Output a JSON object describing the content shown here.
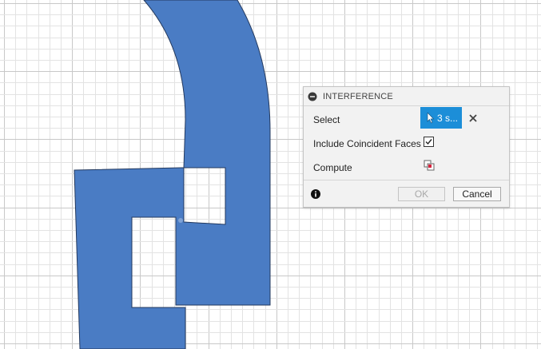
{
  "canvas": {
    "background": "#ffffff",
    "grid_minor_color": "#e3e3e3",
    "grid_major_color": "#c8c8c8",
    "body_fill": "#4a7cc4",
    "body_edge": "#23395e"
  },
  "panel": {
    "title": "INTERFERENCE",
    "collapse_icon": "minus-circle-icon",
    "select_label": "Select",
    "select_value": "3 s...",
    "select_icon": "cursor-arrow-icon",
    "clear_icon": "close-x-icon",
    "coincident_label": "Include Coincident Faces",
    "coincident_checked": true,
    "compute_label": "Compute",
    "compute_icon": "compute-interference-icon",
    "info_icon": "info-icon",
    "ok_label": "OK",
    "cancel_label": "Cancel",
    "accent_color": "#1c8ed8"
  }
}
